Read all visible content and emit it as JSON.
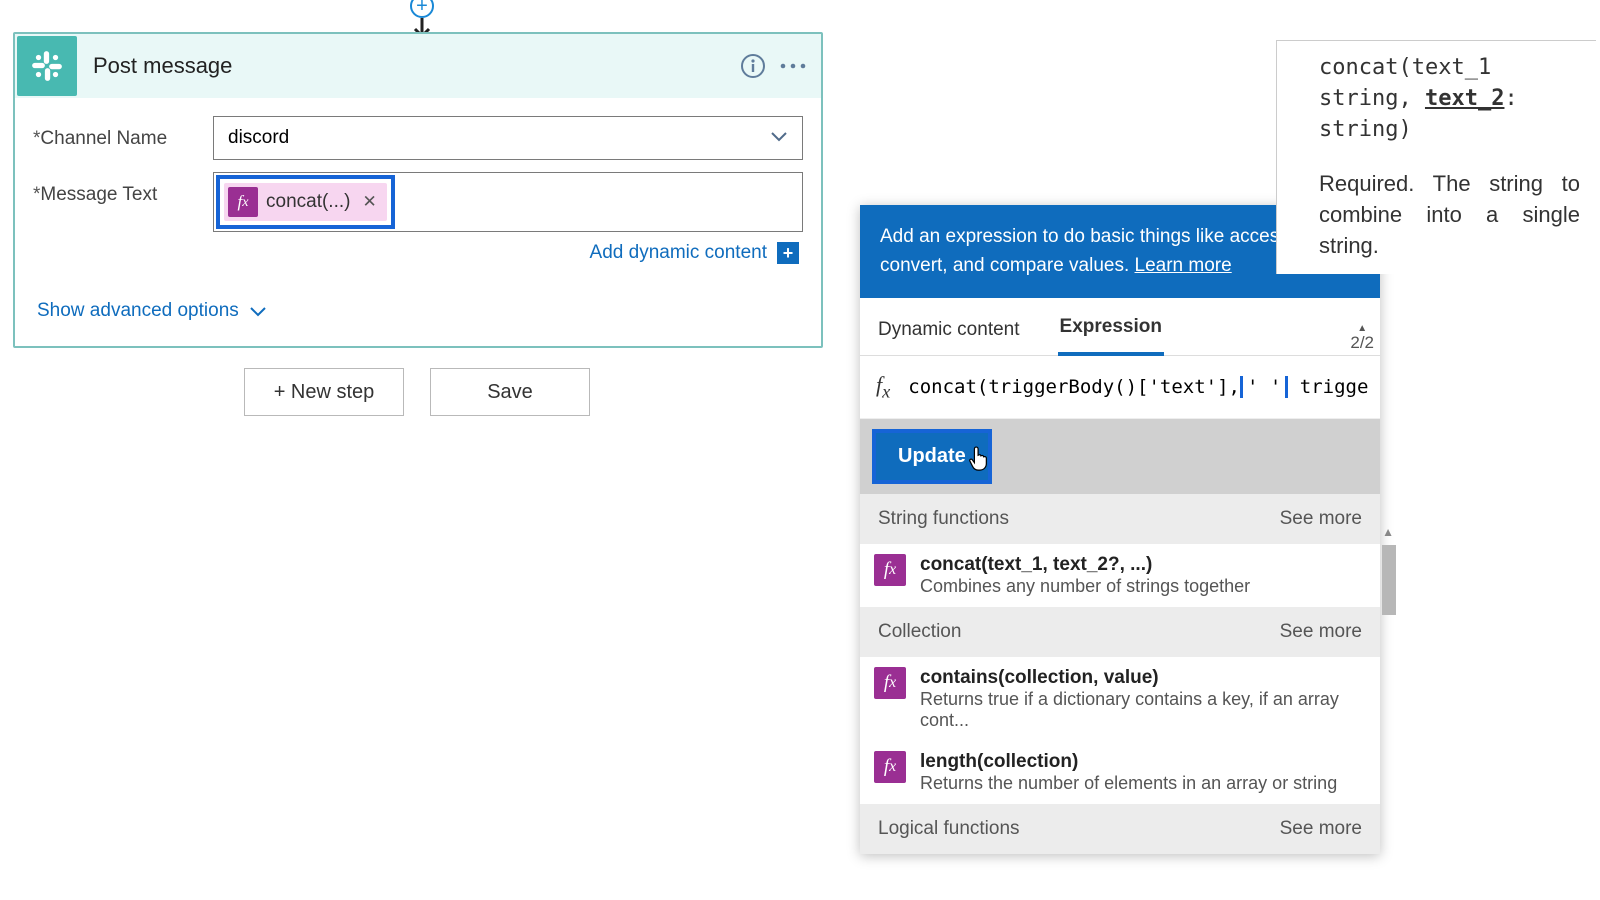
{
  "card": {
    "title": "Post message",
    "channel_label": "Channel Name",
    "channel_value": "discord",
    "message_label": "Message Text",
    "message_token_label": "concat(...)",
    "add_dynamic": "Add dynamic content",
    "advanced": "Show advanced options"
  },
  "buttons": {
    "new_step": "+ New step",
    "save": "Save"
  },
  "popup": {
    "help_text": "Add an expression to do basic things like access, convert, and compare values. ",
    "learn_more": "Learn more",
    "tabs": {
      "dynamic": "Dynamic content",
      "expression": "Expression"
    },
    "counter": "2/2",
    "expr_pre": "concat(triggerBody()['text'],",
    "expr_hl": "' '",
    "expr_post": " trigger",
    "update": "Update",
    "sections": [
      {
        "title": "String functions",
        "see_more": "See more",
        "items": [
          {
            "sig": "concat(text_1, text_2?, ...)",
            "desc": "Combines any number of strings together"
          }
        ]
      },
      {
        "title": "Collection",
        "see_more": "See more",
        "items": [
          {
            "sig": "contains(collection, value)",
            "desc": "Returns true if a dictionary contains a key, if an array cont..."
          },
          {
            "sig": "length(collection)",
            "desc": "Returns the number of elements in an array or string"
          }
        ]
      },
      {
        "title": "Logical functions",
        "see_more": "See more",
        "items": []
      }
    ]
  },
  "tooltip": {
    "sig_pre": "concat(text_1 string, ",
    "sig_cur": "text_2",
    "sig_post": ": string)",
    "desc": "Required. The string to combine into a single string."
  }
}
